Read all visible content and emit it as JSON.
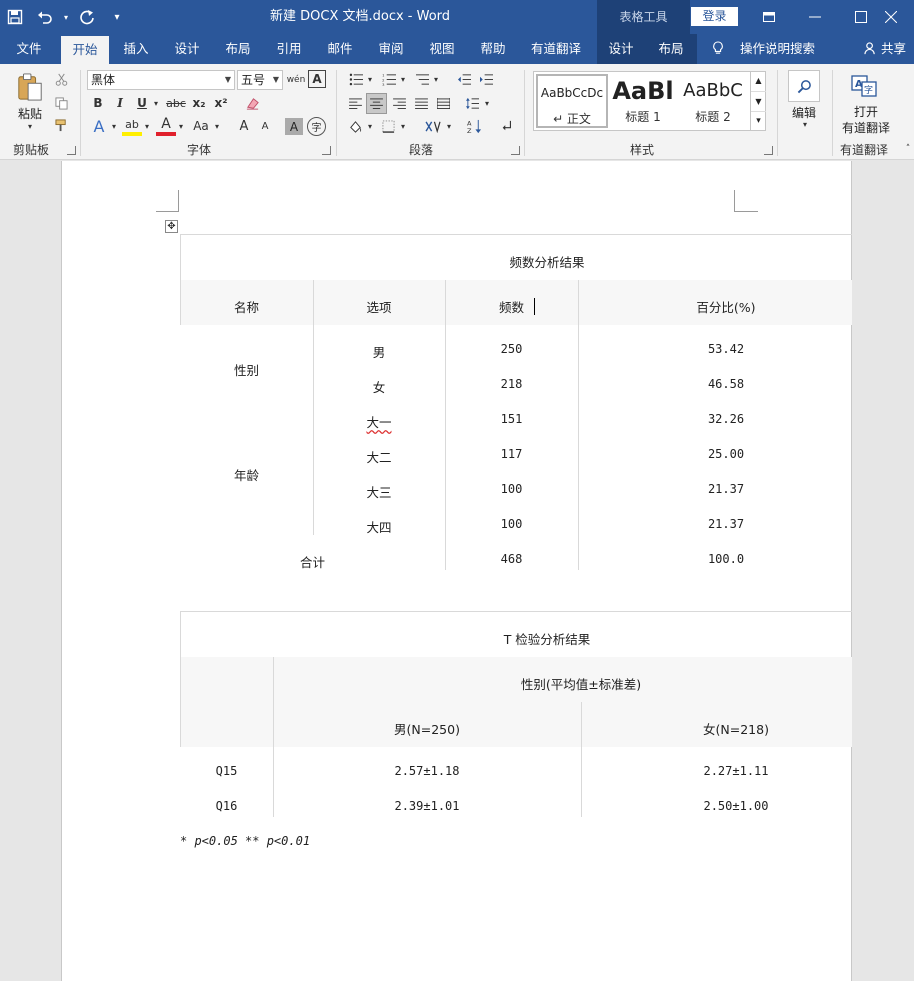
{
  "window": {
    "title": "新建 DOCX 文档.docx  -  Word",
    "context_tools": "表格工具",
    "login": "登录"
  },
  "tabs": {
    "file": "文件",
    "home": "开始",
    "insert": "插入",
    "design": "设计",
    "layout": "布局",
    "references": "引用",
    "mailings": "邮件",
    "review": "审阅",
    "view": "视图",
    "help": "帮助",
    "youdao": "有道翻译",
    "table_design": "设计",
    "table_layout": "布局",
    "search": "操作说明搜索",
    "share": "共享"
  },
  "ribbon": {
    "clipboard": {
      "paste": "粘贴",
      "label": "剪贴板"
    },
    "font": {
      "name": "黑体",
      "size": "五号",
      "label": "字体",
      "bold": "B",
      "italic": "I",
      "underline": "U",
      "strike": "abc",
      "sub": "x₂",
      "sup": "x²",
      "grow": "A",
      "shrink": "A",
      "case": "Aa",
      "char_shade": "A",
      "enclose": "字",
      "phonetic": "wén"
    },
    "paragraph": {
      "label": "段落"
    },
    "styles": {
      "label": "样式",
      "items": [
        {
          "preview": "AaBbCcDc",
          "name": "↵ 正文"
        },
        {
          "preview": "AaBl",
          "name": "标题 1"
        },
        {
          "preview": "AaBbC",
          "name": "标题 2"
        }
      ]
    },
    "editing": {
      "label": "编辑"
    },
    "translate": {
      "label": "打开\n有道翻译",
      "line1": "打开",
      "line2": "有道翻译",
      "group": "有道翻译"
    }
  },
  "table1": {
    "title": "频数分析结果",
    "headers": [
      "名称",
      "选项",
      "频数",
      "百分比(%)"
    ],
    "groups": [
      {
        "name": "性别",
        "rows": [
          {
            "option": "男",
            "count": "250",
            "pct": "53.42"
          },
          {
            "option": "女",
            "count": "218",
            "pct": "46.58"
          }
        ]
      },
      {
        "name": "年龄",
        "rows": [
          {
            "option": "大一",
            "count": "151",
            "pct": "32.26"
          },
          {
            "option": "大二",
            "count": "117",
            "pct": "25.00"
          },
          {
            "option": "大三",
            "count": "100",
            "pct": "21.37"
          },
          {
            "option": "大四",
            "count": "100",
            "pct": "21.37"
          }
        ]
      }
    ],
    "total": {
      "label": "合计",
      "count": "468",
      "pct": "100.0"
    }
  },
  "table2": {
    "title": "T 检验分析结果",
    "group_header": "性别(平均值±标准差)",
    "col_male": "男(N=250)",
    "col_female": "女(N=218)",
    "rows": [
      {
        "item": "Q15",
        "male": "2.57±1.18",
        "female": "2.27±1.11"
      },
      {
        "item": "Q16",
        "male": "2.39±1.01",
        "female": "2.50±1.00"
      }
    ],
    "footnote": "* p<0.05 ** p<0.01"
  },
  "colors": {
    "brand": "#2b579a",
    "ribbon_bg": "#f3f3f3",
    "ctx_tab": "#1e4177"
  }
}
